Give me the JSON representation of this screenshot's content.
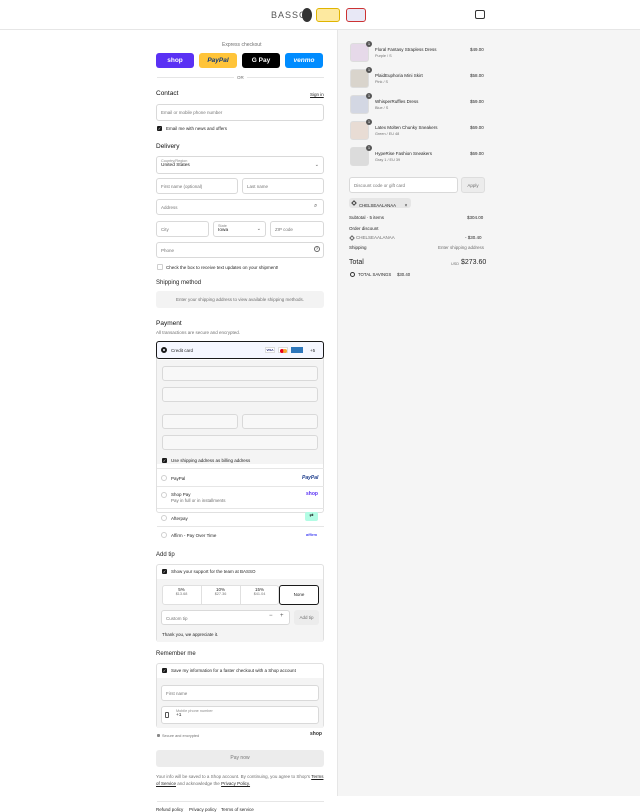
{
  "header": {
    "brand": "BASSO"
  },
  "express": {
    "label": "Express checkout",
    "or": "OR",
    "buttons": [
      "shop",
      "PayPal",
      "G Pay",
      "venmo"
    ],
    "colors": {
      "shop": "#5a31f4",
      "paypal": "#ffc439",
      "gpay": "#000000",
      "venmo": "#008cff"
    }
  },
  "contact": {
    "title": "Contact",
    "signin": "Sign in",
    "email_placeholder": "Email or mobile phone number",
    "news_label": "Email me with news and offers"
  },
  "delivery": {
    "title": "Delivery",
    "country_label": "Country/Region",
    "country_value": "United States",
    "first_name": "First name (optional)",
    "last_name": "Last name",
    "address": "Address",
    "city": "City",
    "state_label": "State",
    "state_value": "Iowa",
    "zip": "ZIP code",
    "phone": "Phone",
    "text_updates": "Check the box to receive text updates on your shipment!"
  },
  "shipping": {
    "title": "Shipping method",
    "note": "Enter your shipping address to view available shipping methods."
  },
  "payment": {
    "title": "Payment",
    "subtitle": "All transactions are secure and encrypted.",
    "credit_card": "Credit card",
    "more_cards": "+5",
    "billing_same": "Use shipping address as billing address",
    "options": [
      {
        "label": "PayPal",
        "sub": "",
        "logo": "PayPal"
      },
      {
        "label": "Shop Pay",
        "sub": "Pay in full or in installments",
        "logo": "shop"
      },
      {
        "label": "Afterpay",
        "sub": "",
        "logo": "afterpay"
      },
      {
        "label": "Affirm - Pay Over Time",
        "sub": "",
        "logo": "affirm"
      }
    ]
  },
  "tip": {
    "title": "Add tip",
    "support": "Show your support for the team at BASSO",
    "options": [
      {
        "pct": "5%",
        "amt": "$13.68"
      },
      {
        "pct": "10%",
        "amt": "$27.36"
      },
      {
        "pct": "15%",
        "amt": "$41.04"
      },
      {
        "pct": "None",
        "amt": ""
      }
    ],
    "custom_placeholder": "Custom tip",
    "add": "Add tip",
    "thanks": "Thank you, we appreciate it."
  },
  "remember": {
    "title": "Remember me",
    "save_label": "Save my information for a faster checkout with a Shop account",
    "first_name": "First name",
    "mobile_label": "Mobile phone number",
    "mobile_value": "+1",
    "secure": "Secure and encrypted",
    "shop": "shop"
  },
  "paynow": {
    "label": "Pay now"
  },
  "legal": {
    "text1": "Your info will be saved to a Shop account. By continuing, you agree to Shop's",
    "terms": "Terms of Service",
    "text2": "and acknowledge the",
    "privacy": "Privacy Policy."
  },
  "footer": {
    "links": [
      "Refund policy",
      "Privacy policy",
      "Terms of service"
    ]
  },
  "cart": {
    "items": [
      {
        "name": "Floral Fantasy Strapless Dress",
        "variant": "Purple / S",
        "price": "$49.00",
        "qty": "1"
      },
      {
        "name": "PlaidEuphoria Mini Skirt",
        "variant": "Pink / S",
        "price": "$58.00",
        "qty": "1"
      },
      {
        "name": "WhisperRuffles Dress",
        "variant": "Blue / S",
        "price": "$59.00",
        "qty": "1"
      },
      {
        "name": "Latex Molten Chunky Sneakers",
        "variant": "Green / EU 48",
        "price": "$69.00",
        "qty": "1"
      },
      {
        "name": "HypeRise Fashion Sneakers",
        "variant": "Gray 1 / EU 39",
        "price": "$69.00",
        "qty": "1"
      }
    ],
    "discount_placeholder": "Discount code or gift card",
    "apply": "Apply",
    "code": "CHELSEAALANAA",
    "subtotal_label": "Subtotal · 5 items",
    "subtotal": "$304.00",
    "order_discount": "Order discount",
    "discount_code": "CHELSEAALANAA",
    "discount_amt": "- $30.40",
    "shipping_label": "Shipping",
    "shipping_val": "Enter shipping address",
    "total_label": "Total",
    "currency": "USD",
    "total": "$273.60",
    "savings_label": "TOTAL SAVINGS",
    "savings": "$30.40"
  }
}
